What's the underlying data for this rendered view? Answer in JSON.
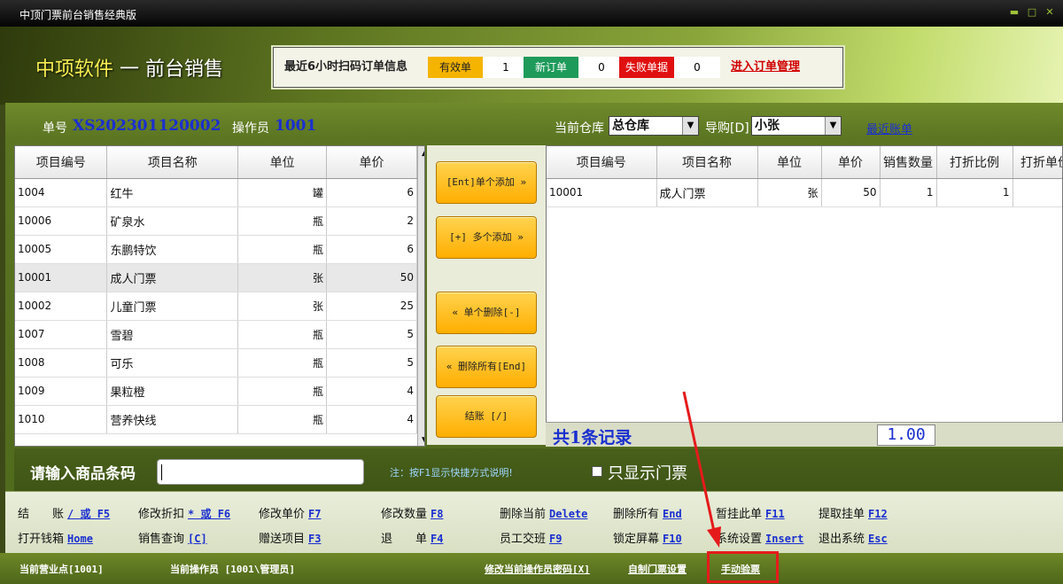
{
  "window": {
    "title": "中顶门票前台销售经典版"
  },
  "brand": {
    "name": "中项软件",
    "dash": "一",
    "module": "前台销售"
  },
  "scan_info": {
    "label": "最近6小时扫码订单信息",
    "valid_label": "有效单",
    "valid_count": "1",
    "new_label": "新订单",
    "new_count": "0",
    "failed_label": "失败单据",
    "failed_count": "0",
    "manage_link": "进入订单管理",
    "colors": {
      "valid": "#f5b400",
      "new": "#1e9a5a",
      "failed": "#e01010"
    }
  },
  "order": {
    "no_label": "单号",
    "no_value": "XS202301120002",
    "operator_label": "操作员",
    "operator_value": "1001",
    "warehouse_label": "当前仓库",
    "warehouse_value": "总仓库",
    "guide_label": "导购[D]",
    "guide_value": "小张",
    "recent_link": "最近账单"
  },
  "product_table": {
    "headers": [
      "项目编号",
      "项目名称",
      "单位",
      "单价"
    ],
    "rows": [
      [
        "1004",
        "红牛",
        "罐",
        "6"
      ],
      [
        "10006",
        "矿泉水",
        "瓶",
        "2"
      ],
      [
        "10005",
        "东鹏特饮",
        "瓶",
        "6"
      ],
      [
        "10001",
        "成人门票",
        "张",
        "50"
      ],
      [
        "10002",
        "儿童门票",
        "张",
        "25"
      ],
      [
        "1007",
        "雪碧",
        "瓶",
        "5"
      ],
      [
        "1008",
        "可乐",
        "瓶",
        "5"
      ],
      [
        "1009",
        "果粒橙",
        "瓶",
        "4"
      ],
      [
        "1010",
        "营养快线",
        "瓶",
        "4"
      ]
    ],
    "selected_row": 3
  },
  "actions": {
    "add_one": "[Ent]单个添加 »",
    "add_many": "[+] 多个添加 »",
    "del_one": "« 单个删除[-]",
    "del_all": "« 删除所有[End]",
    "checkout": "结账 [/]"
  },
  "cart_table": {
    "headers": [
      "项目编号",
      "项目名称",
      "单位",
      "单价",
      "销售数量",
      "打折比例",
      "打折单价"
    ],
    "rows": [
      [
        "10001",
        "成人门票",
        "张",
        "50",
        "1",
        "1",
        ""
      ]
    ],
    "summary": "共1条记录",
    "total": "1.00"
  },
  "barcode": {
    "label": "请输入商品条码",
    "value": "",
    "note": "注：按F1显示快捷方式说明!",
    "only_tickets_label": "只显示门票"
  },
  "shortcuts": [
    {
      "label": "结　　账",
      "key": "/ 或 F5"
    },
    {
      "label": "修改折扣",
      "key": "* 或 F6"
    },
    {
      "label": "修改单价",
      "key": "F7"
    },
    {
      "label": "修改数量",
      "key": "F8"
    },
    {
      "label": "删除当前",
      "key": "Delete"
    },
    {
      "label": "删除所有",
      "key": "End"
    },
    {
      "label": "暂挂此单",
      "key": "F11"
    },
    {
      "label": "提取挂单",
      "key": "F12"
    },
    {
      "label": "打开钱箱",
      "key": "Home"
    },
    {
      "label": "销售查询",
      "key": "[C]"
    },
    {
      "label": "赠送项目",
      "key": "F3"
    },
    {
      "label": "退　　单",
      "key": "F4"
    },
    {
      "label": "员工交班",
      "key": "F9"
    },
    {
      "label": "锁定屏幕",
      "key": "F10"
    },
    {
      "label": "系统设置",
      "key": "Insert"
    },
    {
      "label": "退出系统",
      "key": "Esc"
    }
  ],
  "footer": {
    "point": "当前营业点[1001]",
    "operator": "当前操作员 [1001\\管理员]",
    "change_pwd": "修改当前操作员密码[X]",
    "custom_ticket": "自制门票设置",
    "manual_check": "手动验票"
  }
}
